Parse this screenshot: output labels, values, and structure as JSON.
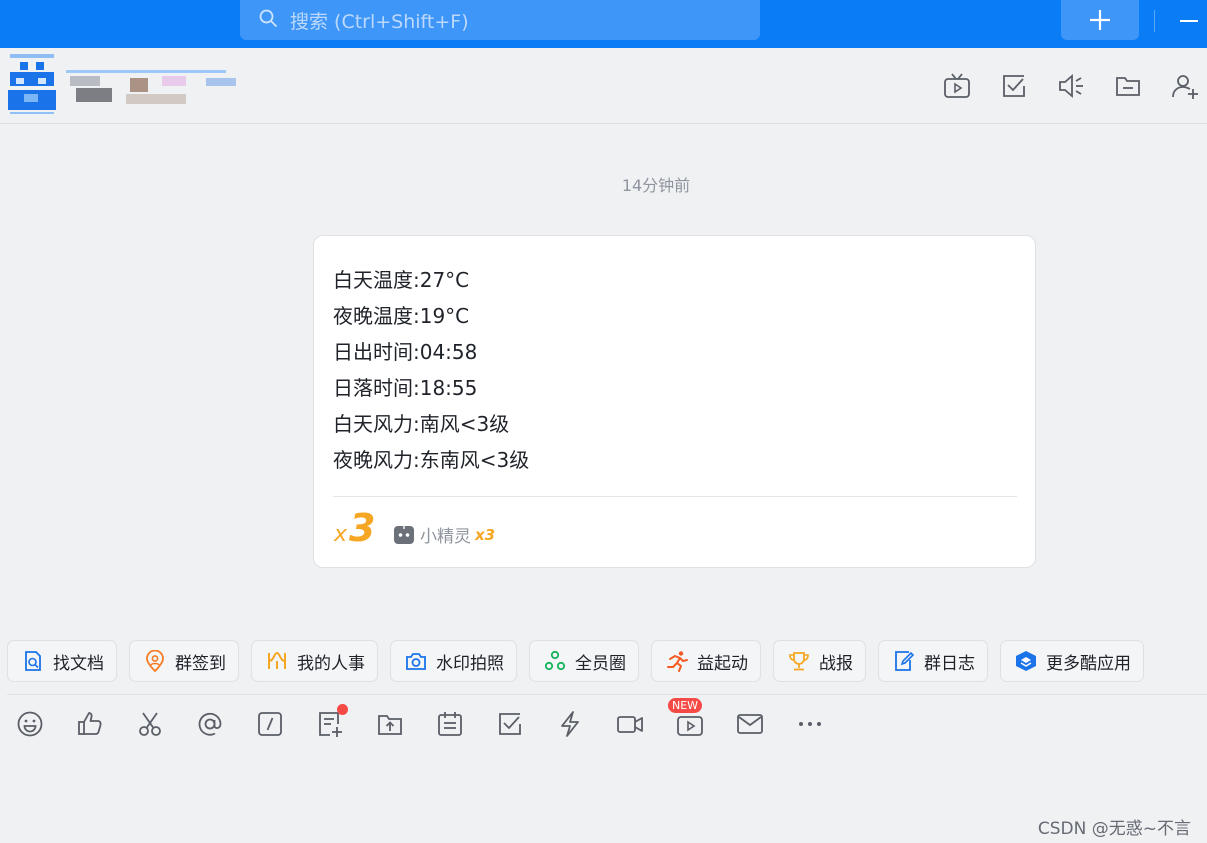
{
  "search": {
    "placeholder": "搜索 (Ctrl+Shift+F)"
  },
  "header": {
    "icons": [
      "tv-icon",
      "checkbox-icon",
      "speaker-icon",
      "folder-icon",
      "add-member-icon"
    ]
  },
  "message": {
    "timestamp": "14分钟前",
    "lines": [
      "白天温度:27°C",
      "夜晚温度:19°C",
      "日出时间:04:58",
      "日落时间:18:55",
      "白天风力:南风<3级",
      "夜晚风力:东南风<3级"
    ],
    "mark_x": "x",
    "mark_num": "3",
    "bot_name": "小精灵",
    "bot_mark": "x3"
  },
  "apps": [
    {
      "label": "找文档",
      "icon": "doc-search-icon",
      "color": "#1a73e8"
    },
    {
      "label": "群签到",
      "icon": "location-icon",
      "color": "#f57b23"
    },
    {
      "label": "我的人事",
      "icon": "hr-icon",
      "color": "#f5a623"
    },
    {
      "label": "水印拍照",
      "icon": "camera-icon",
      "color": "#1a73e8"
    },
    {
      "label": "全员圈",
      "icon": "circle-icon",
      "color": "#14b35c"
    },
    {
      "label": "益起动",
      "icon": "running-icon",
      "color": "#f55a23"
    },
    {
      "label": "战报",
      "icon": "trophy-icon",
      "color": "#f5a623"
    },
    {
      "label": "群日志",
      "icon": "log-icon",
      "color": "#1a73e8"
    },
    {
      "label": "更多酷应用",
      "icon": "apps-icon",
      "color": "#1a73e8"
    }
  ],
  "toolbar": {
    "new_badge": "NEW",
    "icons": [
      "emoji-icon",
      "like-icon",
      "scissors-icon",
      "mention-icon",
      "slash-command-icon",
      "form-icon",
      "upload-icon",
      "calendar-icon",
      "task-icon",
      "ding-icon",
      "video-call-icon",
      "live-icon",
      "mail-icon",
      "more-icon"
    ]
  },
  "watermark": "CSDN @无惑~不言"
}
